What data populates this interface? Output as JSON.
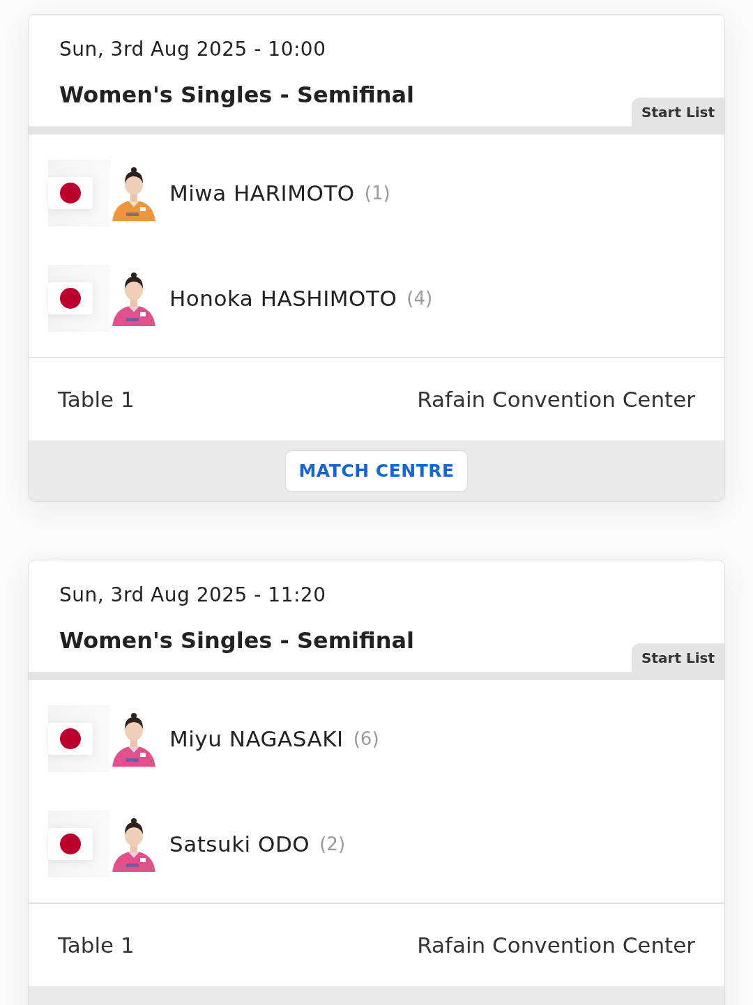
{
  "matches": [
    {
      "datetime": "Sun, 3rd Aug 2025 - 10:00",
      "event": "Women's Singles - Semifinal",
      "tab": "Start List",
      "players": [
        {
          "name": "Miwa HARIMOTO",
          "seed": "(1)"
        },
        {
          "name": "Honoka HASHIMOTO",
          "seed": "(4)"
        }
      ],
      "table": "Table 1",
      "venue": "Rafain Convention Center",
      "button": "MATCH CENTRE"
    },
    {
      "datetime": "Sun, 3rd Aug 2025 - 11:20",
      "event": "Women's Singles - Semifinal",
      "tab": "Start List",
      "players": [
        {
          "name": "Miyu NAGASAKI",
          "seed": "(6)"
        },
        {
          "name": "Satsuki ODO",
          "seed": "(2)"
        }
      ],
      "table": "Table 1",
      "venue": "Rafain Convention Center"
    }
  ]
}
